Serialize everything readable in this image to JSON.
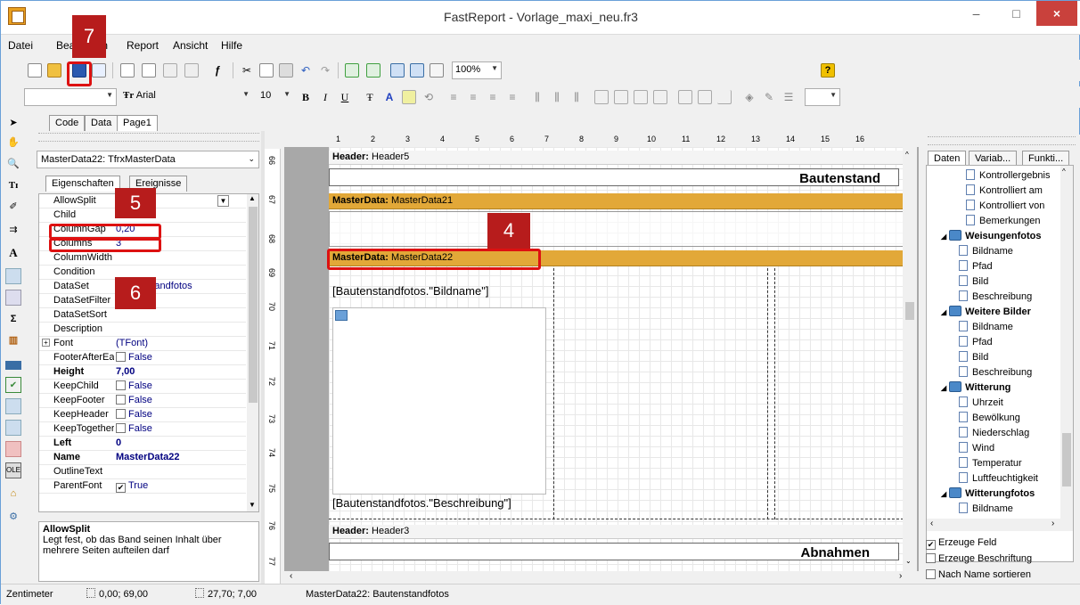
{
  "window": {
    "title": "FastReport - Vorlage_maxi_neu.fr3",
    "min_label": "–",
    "max_label": "□",
    "close_label": "×"
  },
  "menu": [
    "Datei",
    "Bearbeiten",
    "Report",
    "Ansicht",
    "Hilfe"
  ],
  "toolbar": {
    "zoom": "100%",
    "font_name": "Arial",
    "font_size": "10",
    "style_combo": ""
  },
  "tabs": [
    "Code",
    "Data",
    "Page1"
  ],
  "object_inspector": {
    "selected_object": "MasterData22: TfrxMasterData",
    "prop_tabs": [
      "Eigenschaften",
      "Ereignisse"
    ],
    "properties": [
      {
        "name": "AllowSplit",
        "value": ""
      },
      {
        "name": "Child",
        "value": ""
      },
      {
        "name": "ColumnGap",
        "value": "0,20"
      },
      {
        "name": "Columns",
        "value": "3"
      },
      {
        "name": "ColumnWidth",
        "value": ""
      },
      {
        "name": "Condition",
        "value": ""
      },
      {
        "name": "DataSet",
        "value": "Bautenstandfotos"
      },
      {
        "name": "DataSetFilter",
        "value": ""
      },
      {
        "name": "DataSetSort",
        "value": ""
      },
      {
        "name": "Description",
        "value": ""
      },
      {
        "name": "Font",
        "value": "(TFont)"
      },
      {
        "name": "FooterAfterEach",
        "value": "False"
      },
      {
        "name": "Height",
        "value": "7,00"
      },
      {
        "name": "KeepChild",
        "value": "False"
      },
      {
        "name": "KeepFooter",
        "value": "False"
      },
      {
        "name": "KeepHeader",
        "value": "False"
      },
      {
        "name": "KeepTogether",
        "value": "False"
      },
      {
        "name": "Left",
        "value": "0"
      },
      {
        "name": "Name",
        "value": "MasterData22"
      },
      {
        "name": "OutlineText",
        "value": ""
      },
      {
        "name": "ParentFont",
        "value": "True"
      }
    ],
    "description_title": "AllowSplit",
    "description_text": "Legt fest, ob das Band seinen Inhalt über mehrere Seiten aufteilen darf"
  },
  "ruler_h": [
    "1",
    "2",
    "3",
    "4",
    "5",
    "6",
    "7",
    "8",
    "9",
    "10",
    "11",
    "12",
    "13",
    "14",
    "15",
    "16"
  ],
  "ruler_v": [
    "66",
    "67",
    "68",
    "69",
    "70",
    "71",
    "72",
    "73",
    "74",
    "75",
    "76",
    "77"
  ],
  "report": {
    "header5_label": "Header:",
    "header5_name": "Header5",
    "header5_text": "Bautenstand",
    "md21_label": "MasterData:",
    "md21_name": "MasterData21",
    "md22_label": "MasterData:",
    "md22_name": "MasterData22",
    "memo_bildname": "[Bautenstandfotos.\"Bildname\"]",
    "memo_beschreibung": "[Bautenstandfotos.\"Beschreibung\"]",
    "header3_label": "Header:",
    "header3_name": "Header3",
    "header3_text": "Abnahmen"
  },
  "data_tree": {
    "tabs": [
      "Daten",
      "Variab...",
      "Funkti..."
    ],
    "items": [
      {
        "label": "Kontrollergebnis",
        "group": false
      },
      {
        "label": "Kontrolliert am",
        "group": false
      },
      {
        "label": "Kontrolliert von",
        "group": false
      },
      {
        "label": "Bemerkungen",
        "group": false
      },
      {
        "label": "Weisungenfotos",
        "group": true
      },
      {
        "label": "Bildname",
        "group": false
      },
      {
        "label": "Pfad",
        "group": false
      },
      {
        "label": "Bild",
        "group": false
      },
      {
        "label": "Beschreibung",
        "group": false
      },
      {
        "label": "Weitere Bilder",
        "group": true
      },
      {
        "label": "Bildname",
        "group": false
      },
      {
        "label": "Pfad",
        "group": false
      },
      {
        "label": "Bild",
        "group": false
      },
      {
        "label": "Beschreibung",
        "group": false
      },
      {
        "label": "Witterung",
        "group": true
      },
      {
        "label": "Uhrzeit",
        "group": false
      },
      {
        "label": "Bewölkung",
        "group": false
      },
      {
        "label": "Niederschlag",
        "group": false
      },
      {
        "label": "Wind",
        "group": false
      },
      {
        "label": "Temperatur",
        "group": false
      },
      {
        "label": "Luftfeuchtigkeit",
        "group": false
      },
      {
        "label": "Witterungfotos",
        "group": true
      },
      {
        "label": "Bildname",
        "group": false
      }
    ],
    "checks": [
      {
        "label": "Erzeuge Feld",
        "checked": true
      },
      {
        "label": "Erzeuge Beschriftung",
        "checked": false
      },
      {
        "label": "Nach Name sortieren",
        "checked": false
      }
    ]
  },
  "statusbar": {
    "unit": "Zentimeter",
    "position": "0,00; 69,00",
    "size": "27,70; 7,00",
    "object": "MasterData22: Bautenstandfotos"
  },
  "annotations": [
    "7",
    "5",
    "6",
    "4"
  ],
  "colors": {
    "band_gold": "#e2a838",
    "callout": "#b71c1c",
    "highlight": "#dd1111"
  }
}
